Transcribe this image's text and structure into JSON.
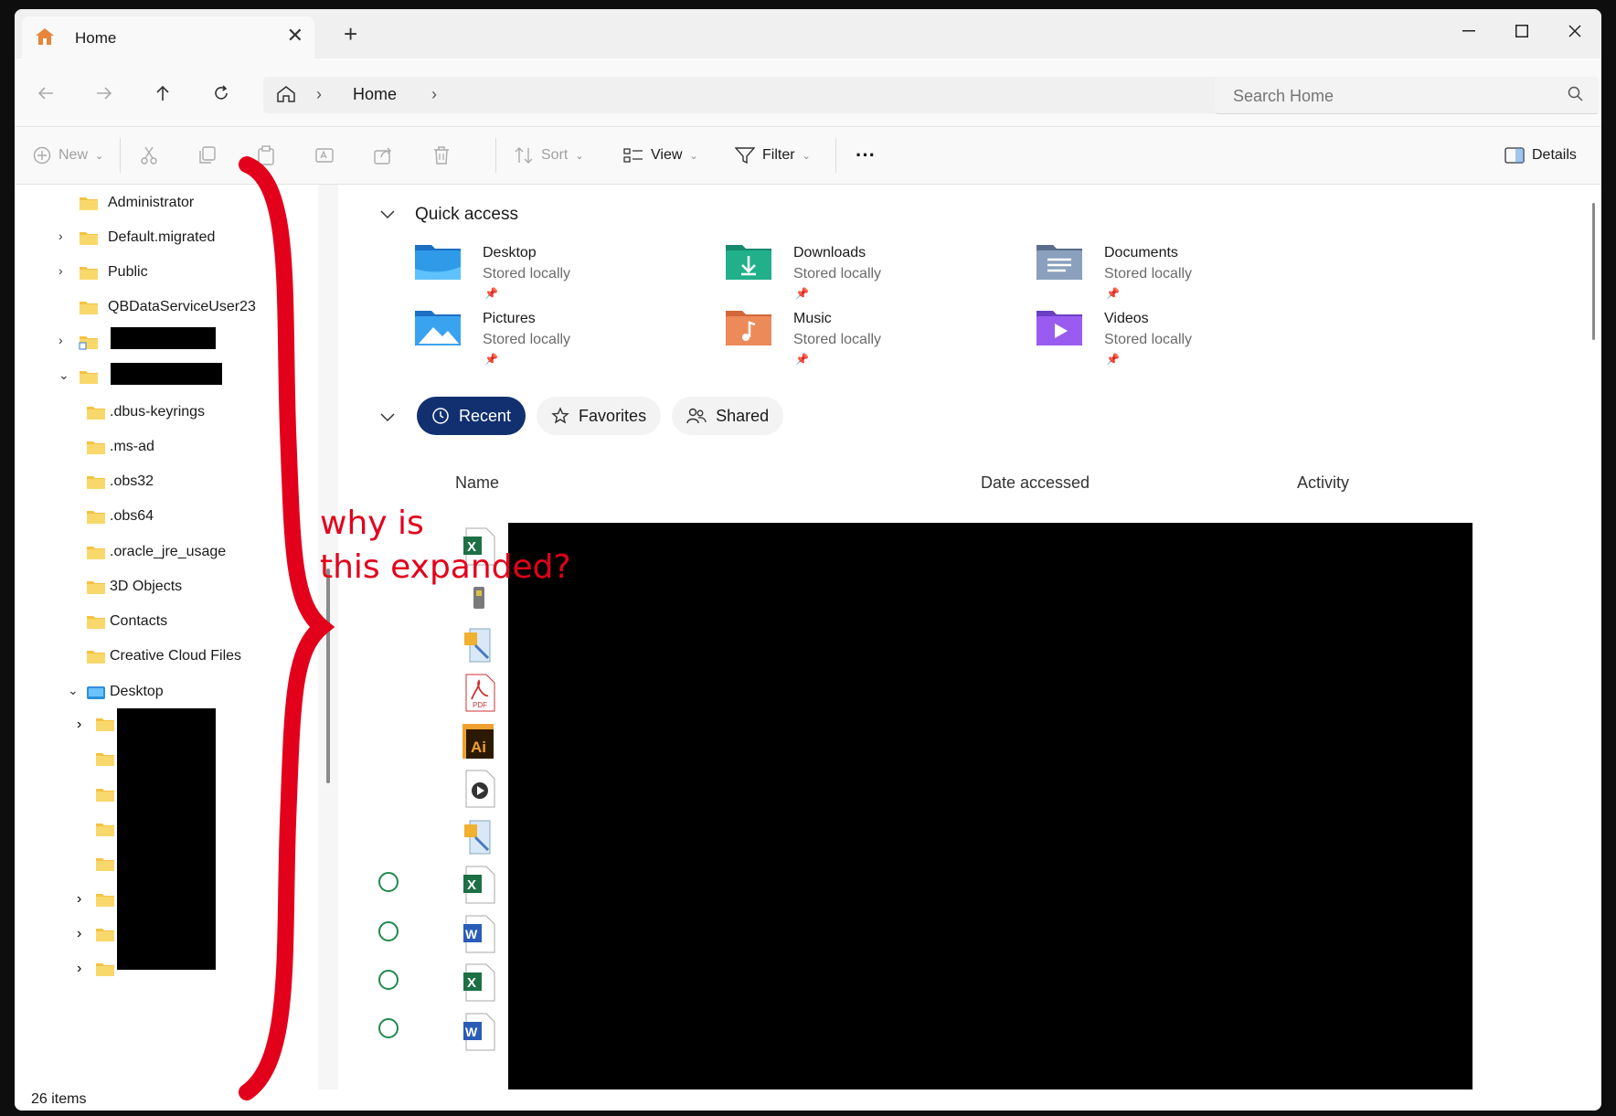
{
  "tab": {
    "title": "Home",
    "close": "✕",
    "new": "+"
  },
  "window_controls": {
    "minimize": "—",
    "maximize": "▢",
    "close": "✕"
  },
  "address": {
    "sep": "›",
    "crumb": "Home"
  },
  "search": {
    "placeholder": "Search Home"
  },
  "toolbar": {
    "new": "New",
    "sort": "Sort",
    "view": "View",
    "filter": "Filter",
    "more": "···",
    "details": "Details"
  },
  "sidebar": {
    "items": [
      {
        "label": "Administrator"
      },
      {
        "label": "Default.migrated"
      },
      {
        "label": "Public"
      },
      {
        "label": "QBDataServiceUser23"
      },
      {
        "label": ".dbus-keyrings"
      },
      {
        "label": ".ms-ad"
      },
      {
        "label": ".obs32"
      },
      {
        "label": ".obs64"
      },
      {
        "label": ".oracle_jre_usage"
      },
      {
        "label": "3D Objects"
      },
      {
        "label": "Contacts"
      },
      {
        "label": "Creative Cloud Files"
      },
      {
        "label": "Desktop"
      }
    ]
  },
  "quick_access": {
    "title": "Quick access",
    "tiles": [
      {
        "name": "Desktop",
        "sub": "Stored locally",
        "icon": "desktop-folder-icon"
      },
      {
        "name": "Downloads",
        "sub": "Stored locally",
        "icon": "downloads-folder-icon"
      },
      {
        "name": "Documents",
        "sub": "Stored locally",
        "icon": "documents-folder-icon"
      },
      {
        "name": "Pictures",
        "sub": "Stored locally",
        "icon": "pictures-folder-icon"
      },
      {
        "name": "Music",
        "sub": "Stored locally",
        "icon": "music-folder-icon"
      },
      {
        "name": "Videos",
        "sub": "Stored locally",
        "icon": "videos-folder-icon"
      }
    ]
  },
  "filters": {
    "recent": "Recent",
    "favorites": "Favorites",
    "shared": "Shared"
  },
  "columns": {
    "name": "Name",
    "date": "Date accessed",
    "activity": "Activity"
  },
  "annotation": {
    "line1": "why is",
    "line2": "this expanded?"
  },
  "status": {
    "items": "26 items"
  },
  "colors": {
    "accent": "#12306f",
    "annotation": "#e3001b",
    "folder": "#f5c242"
  }
}
